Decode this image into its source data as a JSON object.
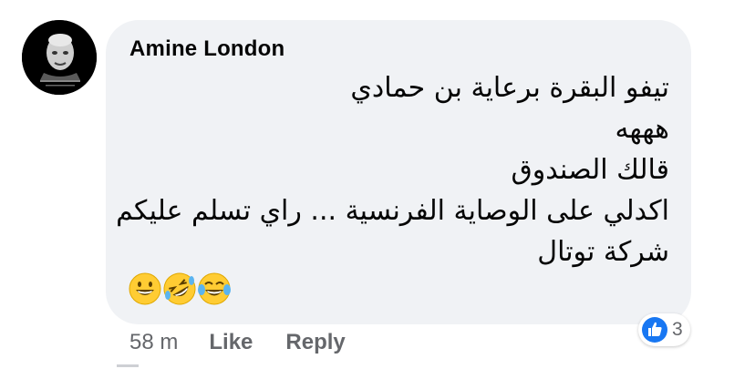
{
  "comment": {
    "author": "Amine London",
    "lines": [
      "تيفو البقرة برعاية بن حمادي",
      "هههه",
      "قالك الصندوق",
      "اكدلي على الوصاية الفرنسية ... راي تسلم عليكم",
      "شركة توتال"
    ],
    "emojis": [
      "grinning-face",
      "rolling-on-floor-laughing",
      "tears-of-joy"
    ]
  },
  "actions": {
    "timestamp": "58 m",
    "like_label": "Like",
    "reply_label": "Reply"
  },
  "reactions": {
    "icon": "thumbs-up",
    "count": "3"
  },
  "colors": {
    "bubble": "#f0f2f5",
    "text": "#050505",
    "secondary": "#65676b",
    "like_blue": "#1877f2",
    "emoji_yellow": "#ffcc33"
  }
}
